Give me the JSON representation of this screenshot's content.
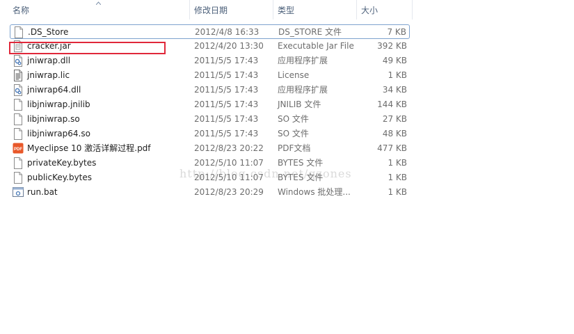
{
  "columns": {
    "name": "名称",
    "date": "修改日期",
    "type": "类型",
    "size": "大小"
  },
  "files": [
    {
      "name": ".DS_Store",
      "date": "2012/4/8 16:33",
      "type": "DS_STORE 文件",
      "size": "7 KB",
      "icon": "blank-file-icon"
    },
    {
      "name": "cracker.jar",
      "date": "2012/4/20 13:30",
      "type": "Executable Jar File",
      "size": "392 KB",
      "icon": "jar-file-icon"
    },
    {
      "name": "jniwrap.dll",
      "date": "2011/5/5 17:43",
      "type": "应用程序扩展",
      "size": "49 KB",
      "icon": "dll-file-icon"
    },
    {
      "name": "jniwrap.lic",
      "date": "2011/5/5 17:43",
      "type": "License",
      "size": "1 KB",
      "icon": "text-file-icon"
    },
    {
      "name": "jniwrap64.dll",
      "date": "2011/5/5 17:43",
      "type": "应用程序扩展",
      "size": "34 KB",
      "icon": "dll-file-icon"
    },
    {
      "name": "libjniwrap.jnilib",
      "date": "2011/5/5 17:43",
      "type": "JNILIB 文件",
      "size": "144 KB",
      "icon": "blank-file-icon"
    },
    {
      "name": "libjniwrap.so",
      "date": "2011/5/5 17:43",
      "type": "SO 文件",
      "size": "27 KB",
      "icon": "blank-file-icon"
    },
    {
      "name": "libjniwrap64.so",
      "date": "2011/5/5 17:43",
      "type": "SO 文件",
      "size": "48 KB",
      "icon": "blank-file-icon"
    },
    {
      "name": "Myeclipse 10 激活详解过程.pdf",
      "date": "2012/8/23 20:22",
      "type": "PDF文档",
      "size": "477 KB",
      "icon": "pdf-file-icon"
    },
    {
      "name": "privateKey.bytes",
      "date": "2012/5/10 11:07",
      "type": "BYTES 文件",
      "size": "1 KB",
      "icon": "blank-file-icon"
    },
    {
      "name": "publicKey.bytes",
      "date": "2012/5/10 11:07",
      "type": "BYTES 文件",
      "size": "1 KB",
      "icon": "blank-file-icon"
    },
    {
      "name": "run.bat",
      "date": "2012/8/23 20:29",
      "type": "Windows 批处理...",
      "size": "1 KB",
      "icon": "bat-file-icon"
    }
  ],
  "watermark": "http://blog.csdn.net/qzones",
  "colors": {
    "highlight": "#e0283a",
    "selection_border": "#7da2ce",
    "header_text": "#4c607a",
    "pdf_icon": "#e8582a"
  }
}
